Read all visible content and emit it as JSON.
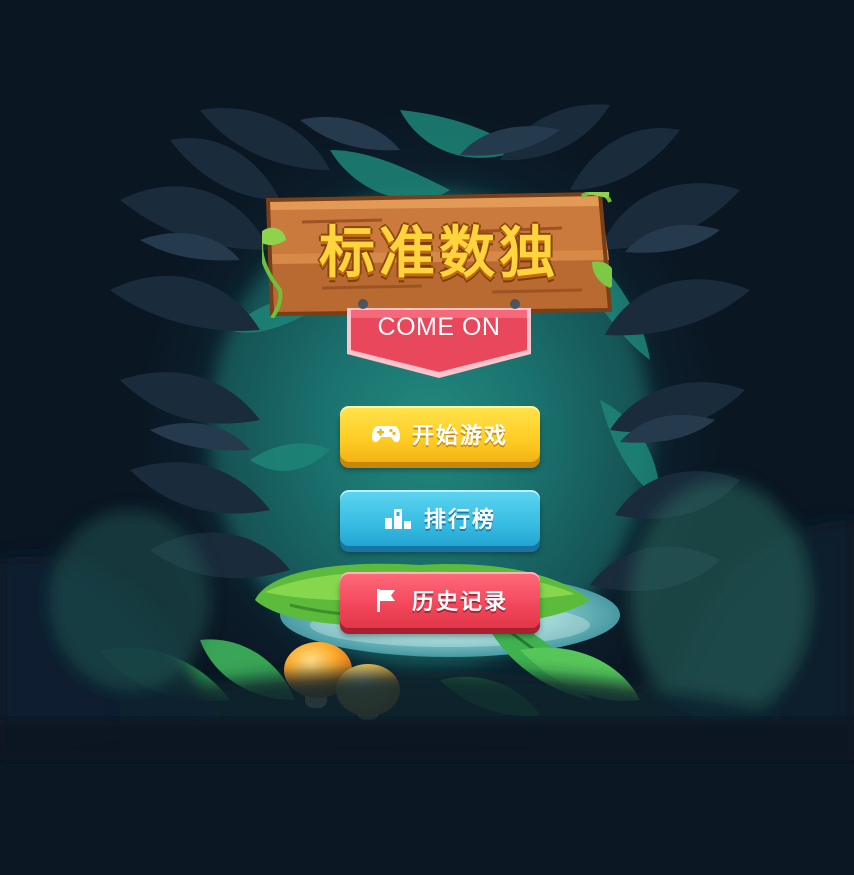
{
  "game": {
    "title": "标准数独",
    "subtitle": "COME ON"
  },
  "menu": {
    "start_label": "开始游戏",
    "start_icon": "gamepad-icon",
    "rank_label": "排行榜",
    "rank_icon": "leaderboard-icon",
    "history_label": "历史记录",
    "history_icon": "flag-icon"
  },
  "colors": {
    "start_button": "#ffcc24",
    "rank_button": "#38bde3",
    "history_button": "#f2475b",
    "ribbon": "#e8475c",
    "title": "#ffd43d",
    "wood": "#c97a3c",
    "background": "#0b1723"
  }
}
